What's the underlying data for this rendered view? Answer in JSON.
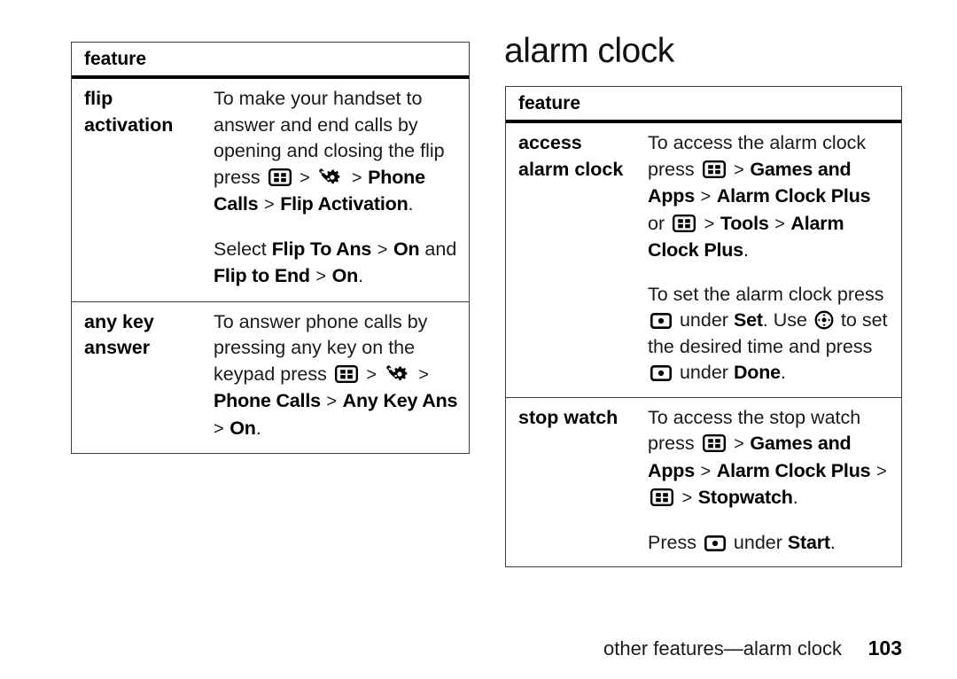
{
  "page": {
    "heading": "alarm clock",
    "footer_caption": "other features—alarm clock",
    "footer_page": "103"
  },
  "icons": {
    "menu": "menu-key-icon",
    "select": "select-key-icon",
    "nav": "navigation-key-icon",
    "tools": "tools-settings-icon",
    "separator": ">"
  },
  "tables": [
    {
      "id": "flip-table",
      "header": "feature",
      "rows": [
        {
          "label_lines": [
            "flip",
            "activation"
          ],
          "paragraphs": [
            {
              "segments": [
                {
                  "type": "text",
                  "value": "To make your handset to answer and end calls by opening and closing the flip press "
                },
                {
                  "type": "icon",
                  "value": "menu"
                },
                {
                  "type": "sep",
                  "value": ">"
                },
                {
                  "type": "icon",
                  "value": "tools"
                },
                {
                  "type": "sep",
                  "value": ">"
                },
                {
                  "type": "term",
                  "value": "Phone Calls"
                },
                {
                  "type": "sep",
                  "value": ">"
                },
                {
                  "type": "term",
                  "value": "Flip Activation"
                },
                {
                  "type": "text",
                  "value": "."
                }
              ]
            },
            {
              "segments": [
                {
                  "type": "text",
                  "value": "Select "
                },
                {
                  "type": "term",
                  "value": "Flip To Ans"
                },
                {
                  "type": "sep",
                  "value": ">"
                },
                {
                  "type": "term",
                  "value": "On"
                },
                {
                  "type": "text",
                  "value": " and "
                },
                {
                  "type": "term",
                  "value": "Flip to End"
                },
                {
                  "type": "sep",
                  "value": ">"
                },
                {
                  "type": "term",
                  "value": "On"
                },
                {
                  "type": "text",
                  "value": "."
                }
              ]
            }
          ]
        },
        {
          "label_lines": [
            "any key",
            "answer"
          ],
          "paragraphs": [
            {
              "segments": [
                {
                  "type": "text",
                  "value": "To answer phone calls by pressing any key on the keypad press "
                },
                {
                  "type": "icon",
                  "value": "menu"
                },
                {
                  "type": "sep",
                  "value": ">"
                },
                {
                  "type": "icon",
                  "value": "tools"
                },
                {
                  "type": "sep",
                  "value": ">"
                },
                {
                  "type": "term",
                  "value": "Phone Calls"
                },
                {
                  "type": "sep",
                  "value": ">"
                },
                {
                  "type": "term",
                  "value": "Any Key Ans"
                },
                {
                  "type": "sep",
                  "value": ">"
                },
                {
                  "type": "term",
                  "value": "On"
                },
                {
                  "type": "text",
                  "value": "."
                }
              ]
            }
          ]
        }
      ]
    },
    {
      "id": "alarm-table",
      "header": "feature",
      "rows": [
        {
          "label_lines": [
            "access",
            "alarm clock"
          ],
          "paragraphs": [
            {
              "segments": [
                {
                  "type": "text",
                  "value": "To access the alarm clock press "
                },
                {
                  "type": "icon",
                  "value": "menu"
                },
                {
                  "type": "sep",
                  "value": ">"
                },
                {
                  "type": "term",
                  "value": "Games and Apps"
                },
                {
                  "type": "sep",
                  "value": ">"
                },
                {
                  "type": "term",
                  "value": "Alarm Clock Plus"
                },
                {
                  "type": "text",
                  "value": " or "
                },
                {
                  "type": "icon",
                  "value": "menu"
                },
                {
                  "type": "sep",
                  "value": ">"
                },
                {
                  "type": "term",
                  "value": "Tools"
                },
                {
                  "type": "sep",
                  "value": ">"
                },
                {
                  "type": "term",
                  "value": "Alarm Clock Plus"
                },
                {
                  "type": "text",
                  "value": "."
                }
              ]
            },
            {
              "segments": [
                {
                  "type": "text",
                  "value": "To set the alarm clock press "
                },
                {
                  "type": "icon",
                  "value": "select"
                },
                {
                  "type": "text",
                  "value": " under "
                },
                {
                  "type": "term",
                  "value": "Set"
                },
                {
                  "type": "text",
                  "value": ". Use "
                },
                {
                  "type": "icon",
                  "value": "nav"
                },
                {
                  "type": "text",
                  "value": " to set the desired time and press "
                },
                {
                  "type": "icon",
                  "value": "select"
                },
                {
                  "type": "text",
                  "value": " under "
                },
                {
                  "type": "term",
                  "value": "Done"
                },
                {
                  "type": "text",
                  "value": "."
                }
              ]
            }
          ]
        },
        {
          "label_lines": [
            "stop watch"
          ],
          "paragraphs": [
            {
              "segments": [
                {
                  "type": "text",
                  "value": "To access the stop watch press "
                },
                {
                  "type": "icon",
                  "value": "menu"
                },
                {
                  "type": "sep",
                  "value": ">"
                },
                {
                  "type": "term",
                  "value": "Games and Apps"
                },
                {
                  "type": "sep",
                  "value": ">"
                },
                {
                  "type": "term",
                  "value": "Alarm Clock Plus"
                },
                {
                  "type": "sep",
                  "value": ">"
                },
                {
                  "type": "icon",
                  "value": "menu"
                },
                {
                  "type": "sep",
                  "value": ">"
                },
                {
                  "type": "term",
                  "value": "Stopwatch"
                },
                {
                  "type": "text",
                  "value": "."
                }
              ]
            },
            {
              "segments": [
                {
                  "type": "text",
                  "value": "Press "
                },
                {
                  "type": "icon",
                  "value": "select"
                },
                {
                  "type": "text",
                  "value": " under "
                },
                {
                  "type": "term",
                  "value": "Start"
                },
                {
                  "type": "text",
                  "value": "."
                }
              ]
            }
          ]
        }
      ]
    }
  ]
}
